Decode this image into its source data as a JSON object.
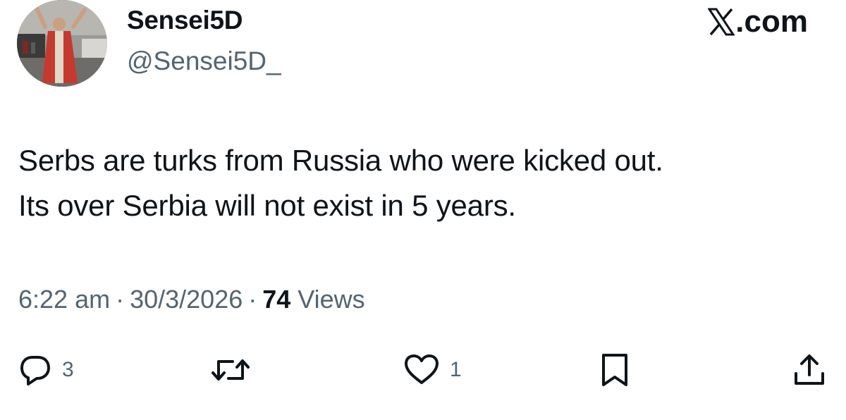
{
  "header": {
    "display_name": "Sensei5D",
    "handle": "@Sensei5D_",
    "brand": ".com",
    "brand_icon": "x-logo-icon"
  },
  "tweet": {
    "lines": [
      "Serbs are turks from Russia who were kicked out.",
      "Its over Serbia will not exist in 5 years."
    ]
  },
  "meta": {
    "time": "6:22 am",
    "date": "30/3/2026",
    "views_count": "74",
    "views_label": "Views",
    "separator": "·"
  },
  "actions": {
    "replies": {
      "icon": "reply-icon",
      "count": "3"
    },
    "retweets": {
      "icon": "retweet-icon",
      "count": ""
    },
    "likes": {
      "icon": "heart-icon",
      "count": "1"
    },
    "bookmark": {
      "icon": "bookmark-icon"
    },
    "share": {
      "icon": "share-icon"
    }
  },
  "colors": {
    "text": "#0f1419",
    "secondary": "#536471",
    "background": "#ffffff"
  }
}
